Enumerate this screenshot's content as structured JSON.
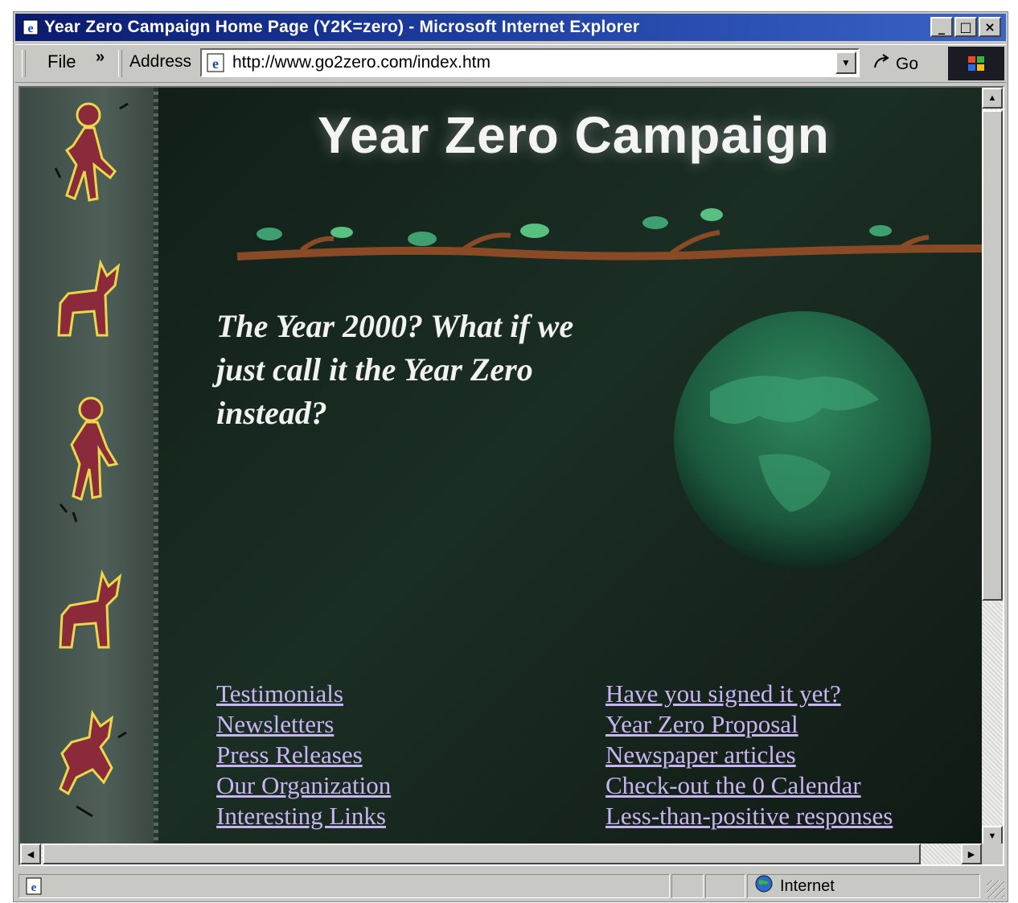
{
  "window": {
    "title": "Year Zero Campaign Home Page (Y2K=zero) - Microsoft Internet Explorer",
    "controls": {
      "minimize": "_",
      "maximize": "□",
      "close": "×"
    }
  },
  "toolbar": {
    "file_menu": "File",
    "more": "»",
    "address_label": "Address",
    "url": "http://www.go2zero.com/index.htm",
    "go_label": "Go"
  },
  "page": {
    "headline": "Year Zero Campaign",
    "tagline": "The Year 2000? What if we just call it the Year Zero instead?",
    "links_left": [
      "Testimonials",
      "Newsletters",
      "Press Releases",
      "Our Organization",
      "Interesting Links"
    ],
    "links_right": [
      "Have you signed it yet?",
      "Year Zero Proposal",
      "Newspaper articles",
      "Check-out the 0 Calendar",
      "Less-than-positive responses"
    ],
    "link_color": "#c8b4f0",
    "background_color": "#14221a"
  },
  "status": {
    "zone": "Internet"
  },
  "icons": [
    "ie-page-icon",
    "go-arrow-icon",
    "windows-logo-icon",
    "globe-icon",
    "scroll-up-icon",
    "scroll-down-icon",
    "scroll-left-icon",
    "scroll-right-icon"
  ]
}
